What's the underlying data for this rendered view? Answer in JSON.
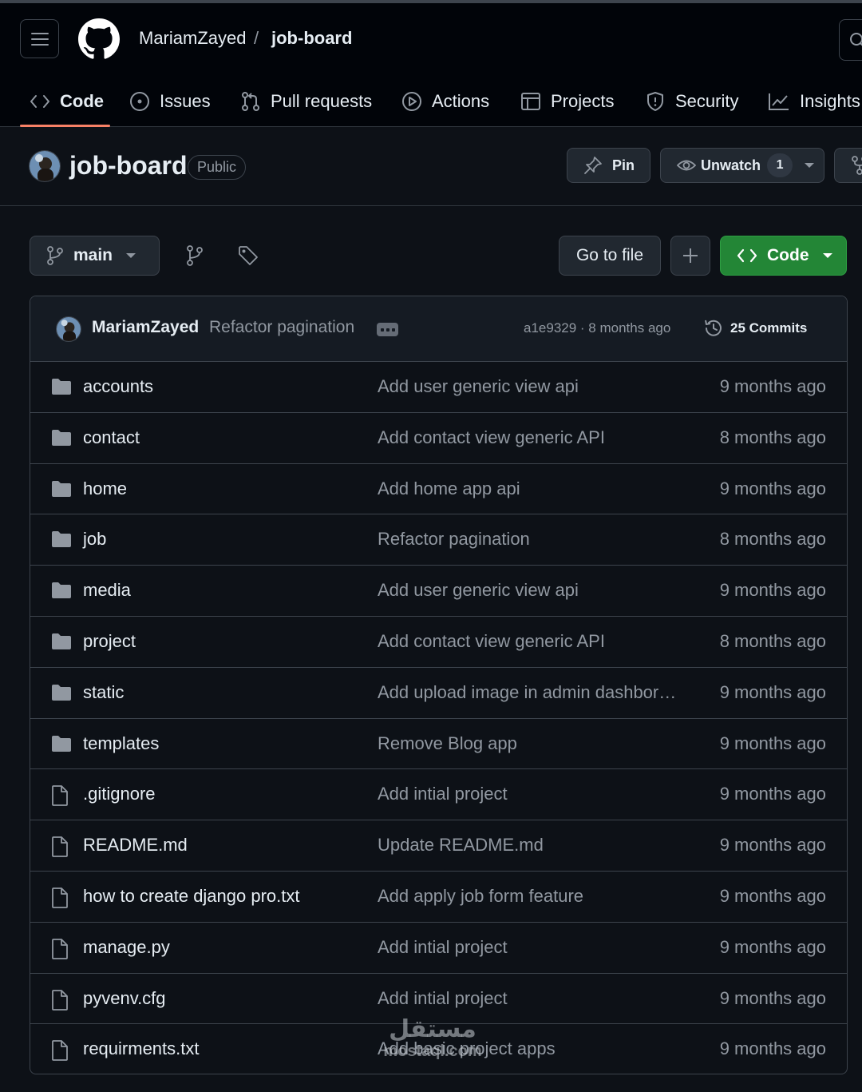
{
  "header": {
    "owner": "MariamZayed",
    "separator": "/",
    "repo": "job-board"
  },
  "nav": {
    "tabs": [
      {
        "label": "Code",
        "icon": "code-icon",
        "active": true
      },
      {
        "label": "Issues",
        "icon": "issue-opened-icon"
      },
      {
        "label": "Pull requests",
        "icon": "git-pull-request-icon"
      },
      {
        "label": "Actions",
        "icon": "play-icon"
      },
      {
        "label": "Projects",
        "icon": "table-icon"
      },
      {
        "label": "Security",
        "icon": "shield-icon"
      },
      {
        "label": "Insights",
        "icon": "graph-icon"
      }
    ]
  },
  "repo": {
    "title": "job-board",
    "visibility": "Public",
    "pin_label": "Pin",
    "watch_label": "Unwatch",
    "watch_count": "1"
  },
  "toolbar": {
    "branch": "main",
    "go_to_file": "Go to file",
    "code_label": "Code"
  },
  "commit": {
    "author": "MariamZayed",
    "message": "Refactor pagination",
    "hash_time": "a1e9329 · 8 months ago",
    "commits_label": "25 Commits"
  },
  "files": [
    {
      "name": "accounts",
      "type": "folder",
      "message": "Add user generic view api",
      "date": "9 months ago"
    },
    {
      "name": "contact",
      "type": "folder",
      "message": "Add contact view generic API",
      "date": "8 months ago"
    },
    {
      "name": "home",
      "type": "folder",
      "message": "Add home app api",
      "date": "9 months ago"
    },
    {
      "name": "job",
      "type": "folder",
      "message": "Refactor pagination",
      "date": "8 months ago"
    },
    {
      "name": "media",
      "type": "folder",
      "message": "Add user generic view api",
      "date": "9 months ago"
    },
    {
      "name": "project",
      "type": "folder",
      "message": "Add contact view generic API",
      "date": "8 months ago"
    },
    {
      "name": "static",
      "type": "folder",
      "message": "Add upload image in admin dashbord…",
      "date": "9 months ago"
    },
    {
      "name": "templates",
      "type": "folder",
      "message": "Remove Blog app",
      "date": "9 months ago"
    },
    {
      "name": ".gitignore",
      "type": "file",
      "message": "Add intial project",
      "date": "9 months ago"
    },
    {
      "name": "README.md",
      "type": "file",
      "message": "Update README.md",
      "date": "9 months ago"
    },
    {
      "name": "how to create django pro.txt",
      "type": "file",
      "message": "Add apply job form feature",
      "date": "9 months ago"
    },
    {
      "name": "manage.py",
      "type": "file",
      "message": "Add intial project",
      "date": "9 months ago"
    },
    {
      "name": "pyvenv.cfg",
      "type": "file",
      "message": "Add intial project",
      "date": "9 months ago"
    },
    {
      "name": "requirments.txt",
      "type": "file",
      "message": "Add basic project apps",
      "date": "9 months ago"
    }
  ],
  "watermark": {
    "arabic": "مستقل",
    "latin": "mostaql.com"
  },
  "colors": {
    "background": "#0d1117",
    "header": "#010409",
    "accent_underline": "#f78166",
    "primary_button": "#238636",
    "muted_text": "#9198a1",
    "folder_icon": "#9198a1"
  }
}
